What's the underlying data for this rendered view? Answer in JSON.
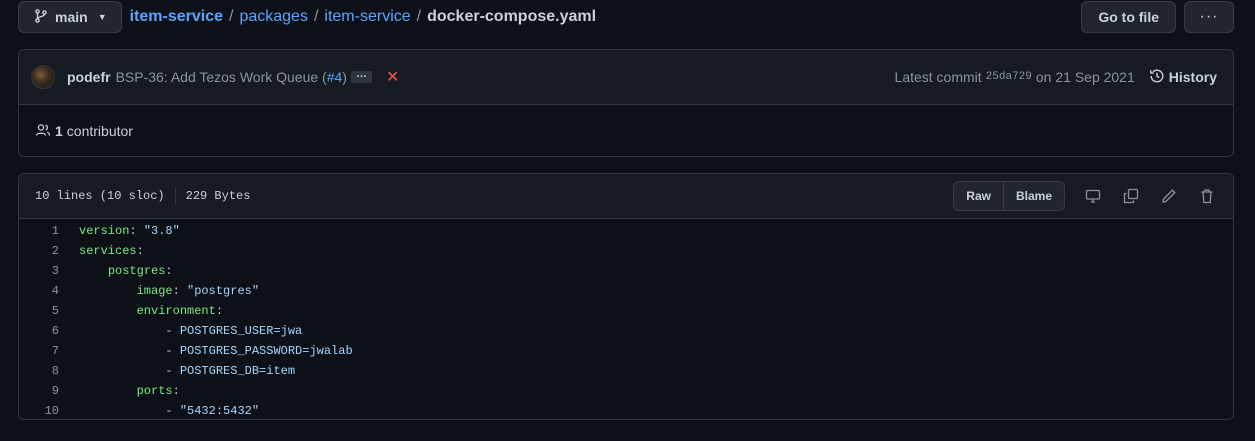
{
  "branch": {
    "name": "main",
    "icon": "git-branch-icon"
  },
  "breadcrumb": {
    "root": "item-service",
    "parts": [
      "packages",
      "item-service"
    ],
    "separator": "/",
    "file": "docker-compose.yaml"
  },
  "actions": {
    "go_to_file": "Go to file",
    "more": "···"
  },
  "commit": {
    "author": "podefr",
    "message": "BSP-36: Add Tezos Work Queue (",
    "pr": "#4",
    "message_end": ")",
    "ellipsis": "…",
    "status": "✕",
    "latest_label": "Latest commit",
    "sha": "25da729",
    "date": "on 21 Sep 2021",
    "history_label": "History"
  },
  "contributors": {
    "count": "1",
    "label": "contributor"
  },
  "file": {
    "lines_info": "10 lines (10 sloc)",
    "size": "229 Bytes",
    "raw": "Raw",
    "blame": "Blame"
  },
  "code": [
    {
      "n": "1",
      "indent": "",
      "key": "version",
      "sep": ": ",
      "val": "\"3.8\""
    },
    {
      "n": "2",
      "indent": "",
      "key": "services",
      "sep": ":",
      "val": ""
    },
    {
      "n": "3",
      "indent": "    ",
      "key": "postgres",
      "sep": ":",
      "val": ""
    },
    {
      "n": "4",
      "indent": "        ",
      "key": "image",
      "sep": ": ",
      "val": "\"postgres\""
    },
    {
      "n": "5",
      "indent": "        ",
      "key": "environment",
      "sep": ":",
      "val": ""
    },
    {
      "n": "6",
      "indent": "            ",
      "key": "",
      "sep": "- ",
      "val": "POSTGRES_USER=jwa"
    },
    {
      "n": "7",
      "indent": "            ",
      "key": "",
      "sep": "- ",
      "val": "POSTGRES_PASSWORD=jwalab"
    },
    {
      "n": "8",
      "indent": "            ",
      "key": "",
      "sep": "- ",
      "val": "POSTGRES_DB=item"
    },
    {
      "n": "9",
      "indent": "        ",
      "key": "ports",
      "sep": ":",
      "val": ""
    },
    {
      "n": "10",
      "indent": "            ",
      "key": "",
      "sep": "- ",
      "val": "\"5432:5432\""
    }
  ]
}
